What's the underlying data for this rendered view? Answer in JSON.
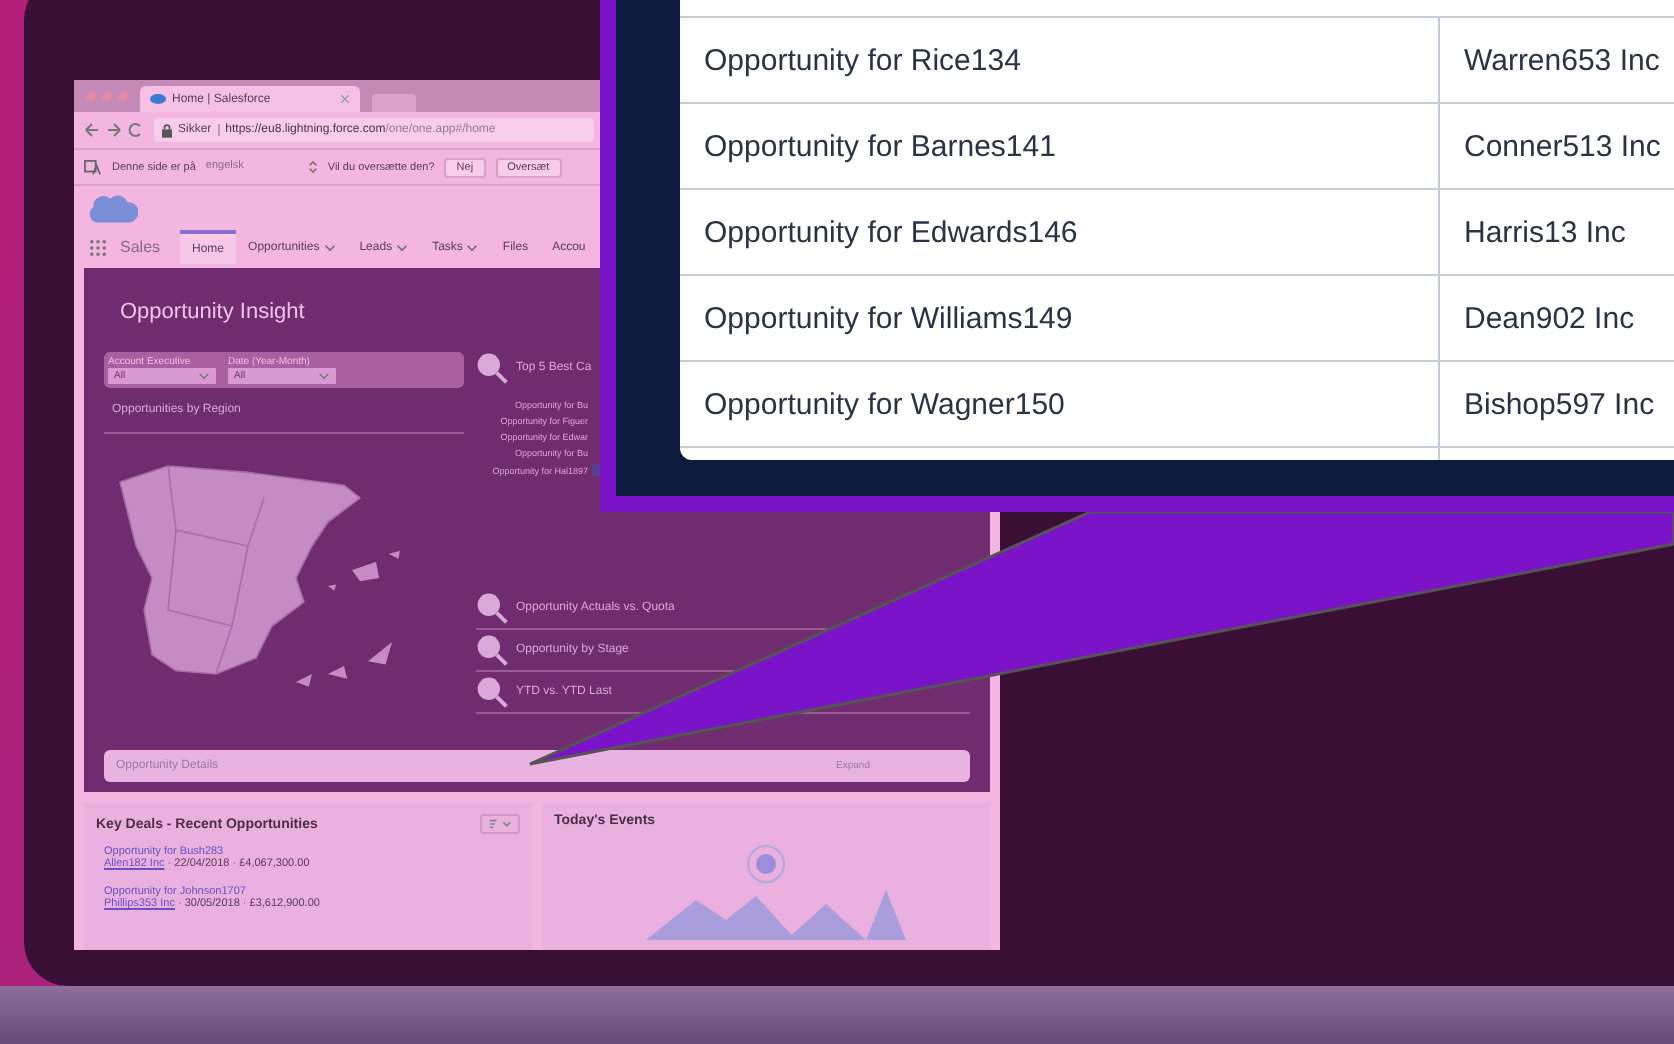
{
  "browser": {
    "tab_title": "Home | Salesforce",
    "security": "Sikker",
    "url_host": "https://eu8.lightning.force.com",
    "url_path": "/one/one.app#/home"
  },
  "translate_bar": {
    "prompt": "Denne side er på",
    "language": "engelsk",
    "question": "Vil du oversætte den?",
    "buttons": [
      "Nej",
      "Oversæt"
    ]
  },
  "nav": {
    "app_name": "Sales",
    "tabs": [
      {
        "label": "Home",
        "selected": true,
        "menu": false
      },
      {
        "label": "Opportunities",
        "selected": false,
        "menu": true
      },
      {
        "label": "Leads",
        "selected": false,
        "menu": true
      },
      {
        "label": "Tasks",
        "selected": false,
        "menu": true
      },
      {
        "label": "Files",
        "selected": false,
        "menu": false
      },
      {
        "label": "Accou",
        "selected": false,
        "menu": false
      }
    ]
  },
  "dashboard": {
    "title": "Opportunity Insight",
    "filters": [
      {
        "label": "Account Executive",
        "value": "All"
      },
      {
        "label": "Date (Year-Month)",
        "value": "All"
      }
    ],
    "region_title": "Opportunities by Region",
    "top5_title": "Top 5 Best Ca",
    "top5_items": [
      "Opportunity for Bu",
      "Opportunity for Figuer",
      "Opportunity for Edwar",
      "Opportunity for Bu",
      "Opportunity for Hal1897"
    ],
    "reports": [
      "Opportunity Actuals vs. Quota",
      "Opportunity by Stage",
      "YTD vs. YTD Last"
    ],
    "details": {
      "title": "Opportunity Details",
      "action": "Expand"
    }
  },
  "key_deals": {
    "title": "Key Deals - Recent Opportunities",
    "items": [
      {
        "name": "Opportunity for Bush283",
        "account": "Allen182 Inc",
        "detail": " · 22/04/2018 · £4,067,300.00"
      },
      {
        "name": "Opportunity for Johnson1707",
        "account": "Phillips353 Inc",
        "detail": " · 30/05/2018 · £3,612,900.00"
      }
    ]
  },
  "events": {
    "title": "Today's Events"
  },
  "callout_table": {
    "rows": [
      {
        "name": "Opportunity for Rice134",
        "account": "Warren653 Inc"
      },
      {
        "name": "Opportunity for Barnes141",
        "account": "Conner513 Inc"
      },
      {
        "name": "Opportunity for Edwards146",
        "account": "Harris13 Inc"
      },
      {
        "name": "Opportunity for Williams149",
        "account": "Dean902 Inc"
      },
      {
        "name": "Opportunity for Wagner150",
        "account": "Bishop597 Inc"
      }
    ]
  }
}
